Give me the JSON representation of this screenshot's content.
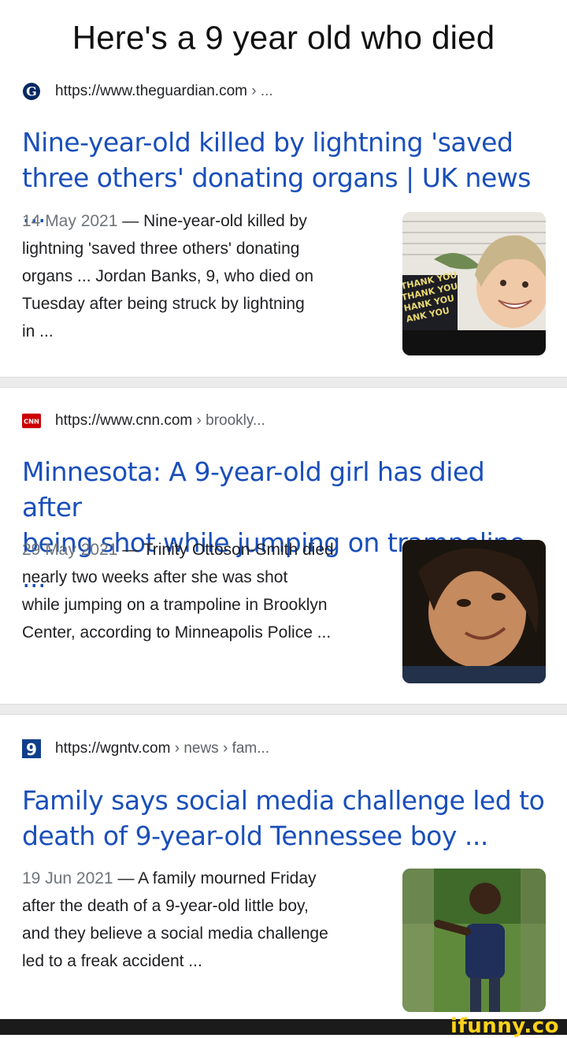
{
  "headline": "Here's a  9 year old who died",
  "results": [
    {
      "url": "https://www.theguardian.com",
      "crumb": "› ...",
      "favicon": "guardian-icon",
      "title_line1": "Nine-year-old killed by lightning 'saved",
      "title_line2": "three others' donating organs | UK news ...",
      "date": "14 May 2021",
      "snippet": [
        "— Nine-year-old killed by",
        "lightning 'saved three others' donating",
        "organs ... Jordan Banks, 9, who died on",
        "Tuesday after being struck by lightning",
        "in ..."
      ],
      "thumb_sign": [
        "THANK YOU",
        "THANK YOU",
        "HANK YOU",
        "ANK YOU"
      ]
    },
    {
      "url": "https://www.cnn.com",
      "crumb": "› brookly...",
      "favicon": "cnn-icon",
      "favicon_text": "CNN",
      "title_line1": "Minnesota: A 9-year-old girl has died after",
      "title_line2": "being shot while jumping on trampoline ...",
      "date": "29 May 2021",
      "snippet": [
        "— Trinity Ottoson-Smith died",
        "nearly two weeks after she was shot",
        "while jumping on a trampoline in Brooklyn",
        "Center, according to Minneapolis Police ..."
      ]
    },
    {
      "url": "https://wgntv.com",
      "crumb": "› news › fam...",
      "favicon": "wgn-icon",
      "favicon_text": "9",
      "title_line1": "Family says social media challenge led to",
      "title_line2": "death of 9-year-old Tennessee boy ...",
      "date": "19 Jun 2021",
      "snippet": [
        "— A family mourned Friday",
        "after the death of a 9-year-old little boy,",
        "and they believe a social media challenge",
        "led to a freak accident ..."
      ]
    }
  ],
  "footer": {
    "brand": "ifunny.co"
  },
  "colors": {
    "title": "#1a4fba",
    "date": "#70757a",
    "separator": "#ebebeb",
    "brand": "#ffd21a"
  }
}
